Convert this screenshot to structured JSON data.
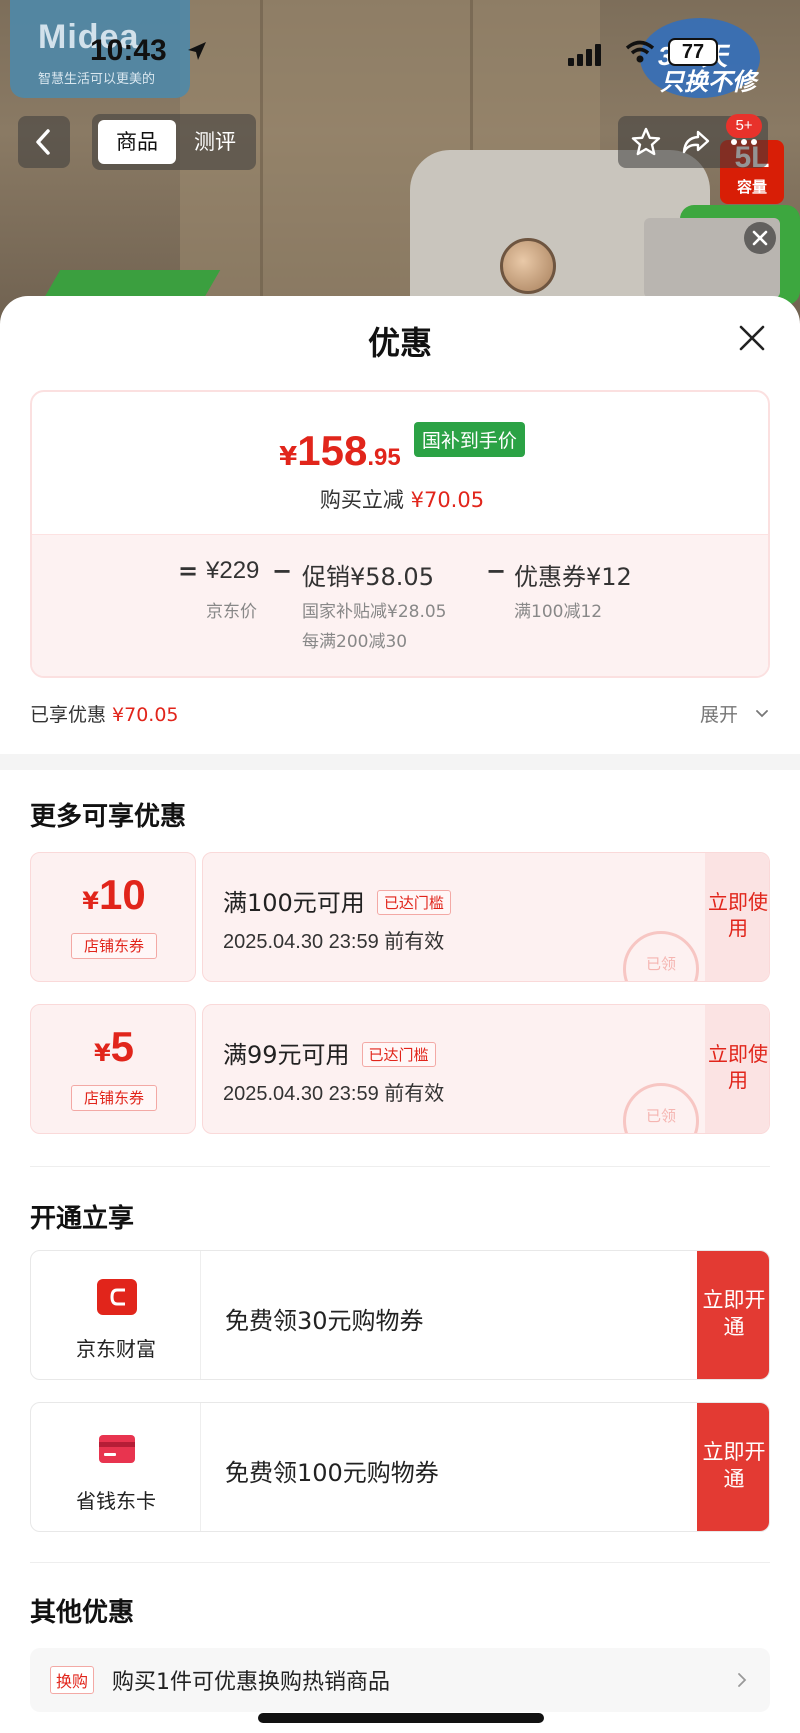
{
  "status_bar": {
    "time": "10:43",
    "battery": "77"
  },
  "brand": {
    "logo": "Midea",
    "slogan": "智慧生活可以更美的"
  },
  "promo_badge": {
    "line1": "365天",
    "line2": "只换不修"
  },
  "capacity_badge": {
    "value": "5L",
    "label": "容量"
  },
  "nav": {
    "tabs": [
      {
        "label": "商品"
      },
      {
        "label": "测评"
      }
    ],
    "message_count": "5+"
  },
  "sheet": {
    "title": "优惠",
    "price": {
      "currency": "¥",
      "integer": "158",
      "decimal": ".95",
      "tag": "国补到手价",
      "sub_label": "购买立减",
      "sub_value": "¥70.05"
    },
    "calc": {
      "eq": "=",
      "base_value": "¥229",
      "base_label": "京东价",
      "minus": "−",
      "promo_value": "促销¥58.05",
      "promo_detail_1": "国家补贴减¥28.05",
      "promo_detail_2": "每满200减30",
      "coupon_value": "优惠券¥12",
      "coupon_detail": "满100减12"
    },
    "enjoyed_label": "已享优惠",
    "enjoyed_value": "¥70.05",
    "expand_label": "展开",
    "more_title": "更多可享优惠",
    "coupons": [
      {
        "currency": "¥",
        "amount": "10",
        "type": "店铺东券",
        "condition": "满100元可用",
        "badge": "已达门槛",
        "expiry": "2025.04.30 23:59 前有效",
        "stamp": "已领",
        "button": "立即使用"
      },
      {
        "currency": "¥",
        "amount": "5",
        "type": "店铺东券",
        "condition": "满99元可用",
        "badge": "已达门槛",
        "expiry": "2025.04.30 23:59 前有效",
        "stamp": "已领",
        "button": "立即使用"
      }
    ],
    "open_title": "开通立享",
    "open_items": [
      {
        "name": "京东财富",
        "text": "免费领30元购物券",
        "button": "立即开通"
      },
      {
        "name": "省钱东卡",
        "text": "免费领100元购物券",
        "button": "立即开通"
      }
    ],
    "other_title": "其他优惠",
    "other_item": {
      "tag": "换购",
      "text": "购买1件可优惠换购热销商品"
    }
  },
  "colors": {
    "accent_red": "#e1251b",
    "green_tag": "#2ba245",
    "button_red": "#e33a33"
  }
}
